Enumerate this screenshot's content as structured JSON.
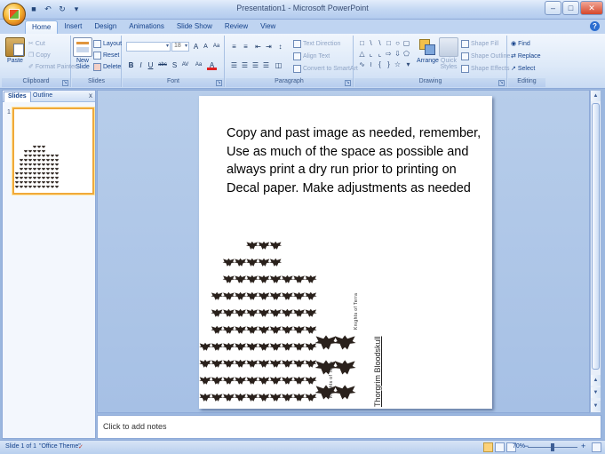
{
  "window": {
    "title": "Presentation1 - Microsoft PowerPoint",
    "qat": [
      "save-icon",
      "undo-icon",
      "redo-icon",
      "customize-icon"
    ]
  },
  "tabs": [
    "Home",
    "Insert",
    "Design",
    "Animations",
    "Slide Show",
    "Review",
    "View"
  ],
  "active_tab": "Home",
  "ribbon": {
    "clipboard": {
      "label": "Clipboard",
      "paste": "Paste",
      "cut": "Cut",
      "copy": "Copy",
      "format_painter": "Format Painter"
    },
    "slides": {
      "label": "Slides",
      "new_slide": "New Slide",
      "layout": "Layout",
      "reset": "Reset",
      "delete": "Delete"
    },
    "font": {
      "label": "Font",
      "font_name": "",
      "font_size": "18",
      "grow": "A",
      "shrink": "A",
      "clear": "Aa",
      "bold": "B",
      "italic": "I",
      "underline": "U",
      "strike": "abc",
      "shadow": "S",
      "spacing": "AV",
      "case": "Aa",
      "color": "A"
    },
    "paragraph": {
      "label": "Paragraph",
      "text_direction": "Text Direction",
      "align_text": "Align Text",
      "convert_smartart": "Convert to SmartArt"
    },
    "drawing": {
      "label": "Drawing",
      "arrange": "Arrange",
      "quick_styles": "Quick Styles",
      "shape_fill": "Shape Fill",
      "shape_outline": "Shape Outline",
      "shape_effects": "Shape Effects"
    },
    "editing": {
      "label": "Editing",
      "find": "Find",
      "replace": "Replace",
      "select": "Select"
    }
  },
  "left_pane": {
    "tabs": [
      "Slides",
      "Outline"
    ],
    "active": "Slides",
    "close": "x",
    "slide_number": "1"
  },
  "slide": {
    "text_lines": [
      "Copy and past image as needed, remember,",
      "Use as much of the space as possible and",
      "always print a dry run prior to printing on",
      "Decal paper.  Make adjustments as needed"
    ],
    "caption_small_a": "Knights of Terra",
    "caption_small_b": "Knights of Terra",
    "caption_name": "Thorgrim Bloodskull",
    "emblem_icon": "double-headed-eagle-icon",
    "emblem_columns": [
      4,
      7,
      9,
      9,
      10,
      10,
      10,
      8,
      8,
      8,
      3,
      3
    ]
  },
  "notes": {
    "placeholder": "Click to add notes"
  },
  "status": {
    "slide": "Slide 1 of 1",
    "theme": "\"Office Theme\"",
    "zoom": "70%",
    "zoom_level": 0.5
  },
  "colors": {
    "accent": "#f0a93b",
    "ribbon": "#dde9f8",
    "frame": "#9bb7df"
  }
}
